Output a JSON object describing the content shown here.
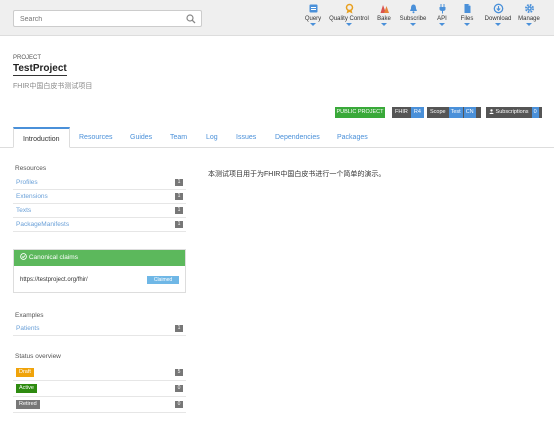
{
  "search": {
    "placeholder": "Search"
  },
  "nav": [
    {
      "label": "Query",
      "icon": "query-icon"
    },
    {
      "label": "Quality Control",
      "icon": "quality-control-icon"
    },
    {
      "label": "Bake",
      "icon": "bake-icon"
    },
    {
      "label": "Subscribe",
      "icon": "bell-icon"
    },
    {
      "label": "API",
      "icon": "api-plug-icon"
    },
    {
      "label": "Files",
      "icon": "files-icon"
    },
    {
      "label": "Download",
      "icon": "download-icon"
    },
    {
      "label": "Manage",
      "icon": "gear-icon"
    }
  ],
  "project": {
    "kicker": "PROJECT",
    "title": "TestProject",
    "subtitle": "FHIR中国白皮书测试项目"
  },
  "badges": {
    "public": "PUBLIC PROJECT",
    "fhir_key": "FHIR",
    "fhir_value": "R4",
    "scope_key": "Scope",
    "scope_value": "Test",
    "scope_lang": "CN",
    "subs_key": "Subscriptions",
    "subs_value": "0"
  },
  "tabs": [
    "Introduction",
    "Resources",
    "Guides",
    "Team",
    "Log",
    "Issues",
    "Dependencies",
    "Packages"
  ],
  "sidebar": {
    "resources_title": "Resources",
    "resources": [
      {
        "label": "Profiles",
        "count": "1"
      },
      {
        "label": "Extensions",
        "count": "1"
      },
      {
        "label": "Texts",
        "count": "1"
      },
      {
        "label": "PackageManifests",
        "count": "1"
      }
    ],
    "canonical": {
      "title": "Canonical claims",
      "url": "https://testproject.org/fhir/",
      "tag": "Claimed"
    },
    "examples_title": "Examples",
    "examples": [
      {
        "label": "Patients",
        "count": "1"
      }
    ],
    "status_title": "Status overview",
    "status": [
      {
        "label": "Draft",
        "count": "5",
        "color": "#f0a30a"
      },
      {
        "label": "Active",
        "count": "0",
        "color": "#2e8b10"
      },
      {
        "label": "Retired",
        "count": "0",
        "color": "#777777"
      }
    ]
  },
  "main": {
    "intro": "本测试项目用于为FHIR中国白皮书进行一个简单的演示。"
  }
}
